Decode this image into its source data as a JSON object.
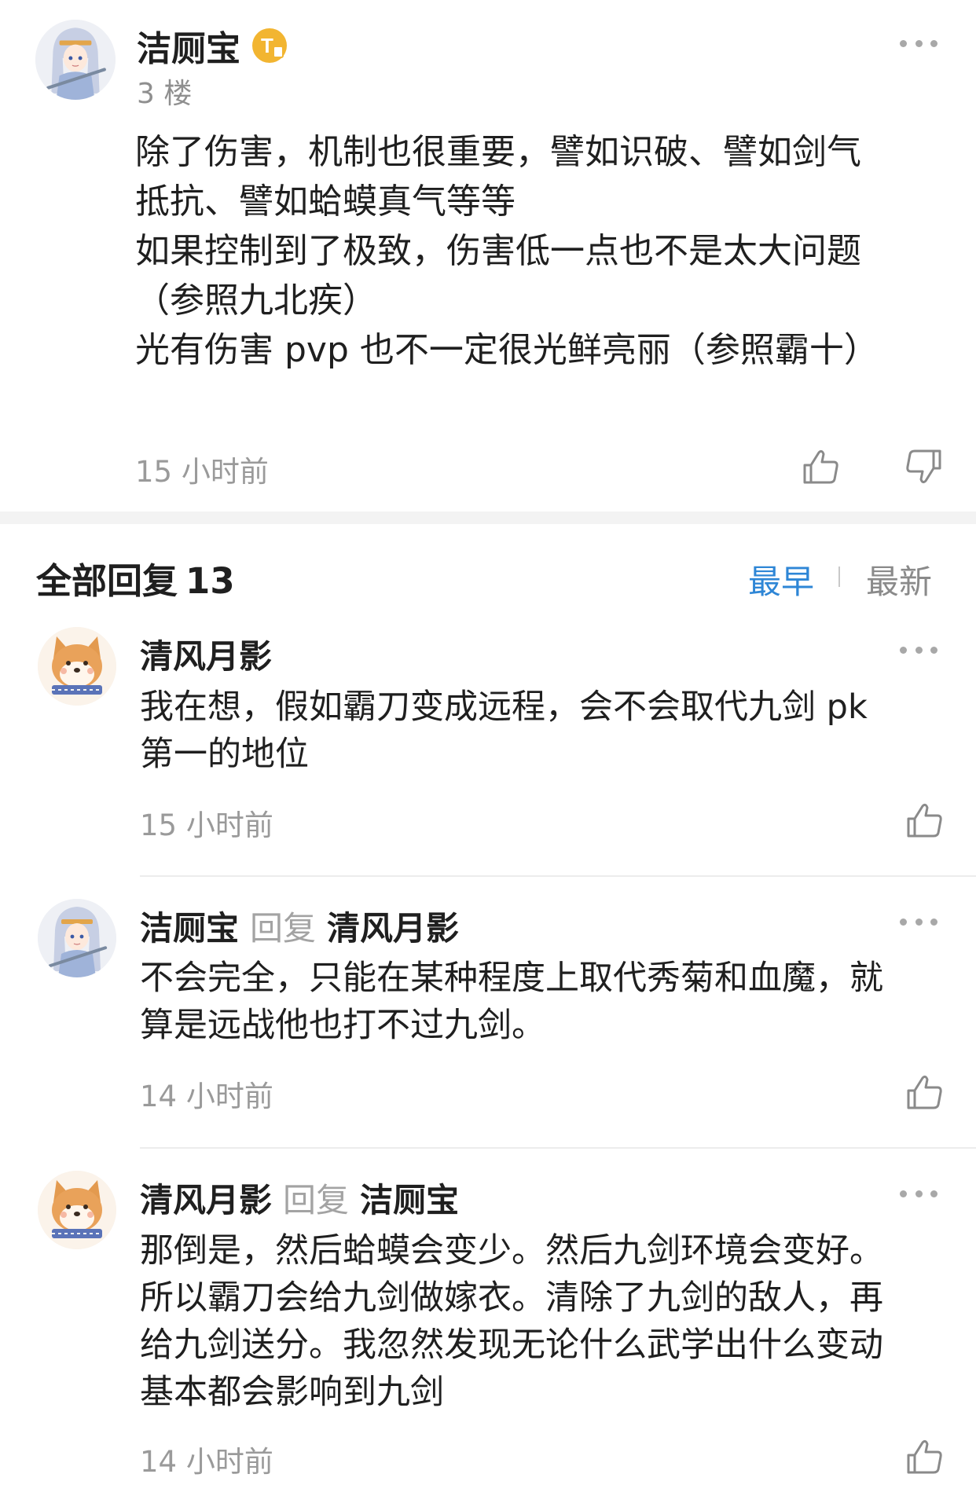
{
  "post": {
    "username": "洁厕宝",
    "badge": "T",
    "floor": "3 楼",
    "body_lines": [
      "除了伤害，机制也很重要，譬如识破、譬如剑气",
      "抵抗、譬如蛤蟆真气等等",
      "如果控制到了极致，伤害低一点也不是太大问题",
      "（参照九北疾）",
      "光有伤害 pvp 也不一定很光鲜亮丽（参照霸十）"
    ],
    "time": "15 小时前",
    "icons": [
      "more-icon",
      "thumb-up-icon",
      "thumb-down-icon"
    ]
  },
  "replies_header": {
    "label": "全部回复",
    "count": "13",
    "sort_earliest": "最早",
    "sort_latest": "最新"
  },
  "reply_word": "回复",
  "replies": [
    {
      "user": "清风月影",
      "reply_to": "",
      "lines": [
        "我在想，假如霸刀变成远程，会不会取代九剑 pk",
        "第一的地位"
      ],
      "time": "15 小时前"
    },
    {
      "user": "洁厕宝",
      "reply_to": "清风月影",
      "lines": [
        "不会完全，只能在某种程度上取代秀菊和血魔，就",
        "算是远战他也打不过九剑。"
      ],
      "time": "14 小时前"
    },
    {
      "user": "清风月影",
      "reply_to": "洁厕宝",
      "lines": [
        "那倒是，然后蛤蟆会变少。然后九剑环境会变好。",
        "所以霸刀会给九剑做嫁衣。清除了九剑的敌人，再",
        "给九剑送分。我忽然发现无论什么武学出什么变动",
        "基本都会影响到九剑"
      ],
      "time": "14 小时前"
    }
  ],
  "colors": {
    "accent": "#2e86d6",
    "meta_gray": "#9a9a9a",
    "badge_gold": "#f2b531"
  }
}
